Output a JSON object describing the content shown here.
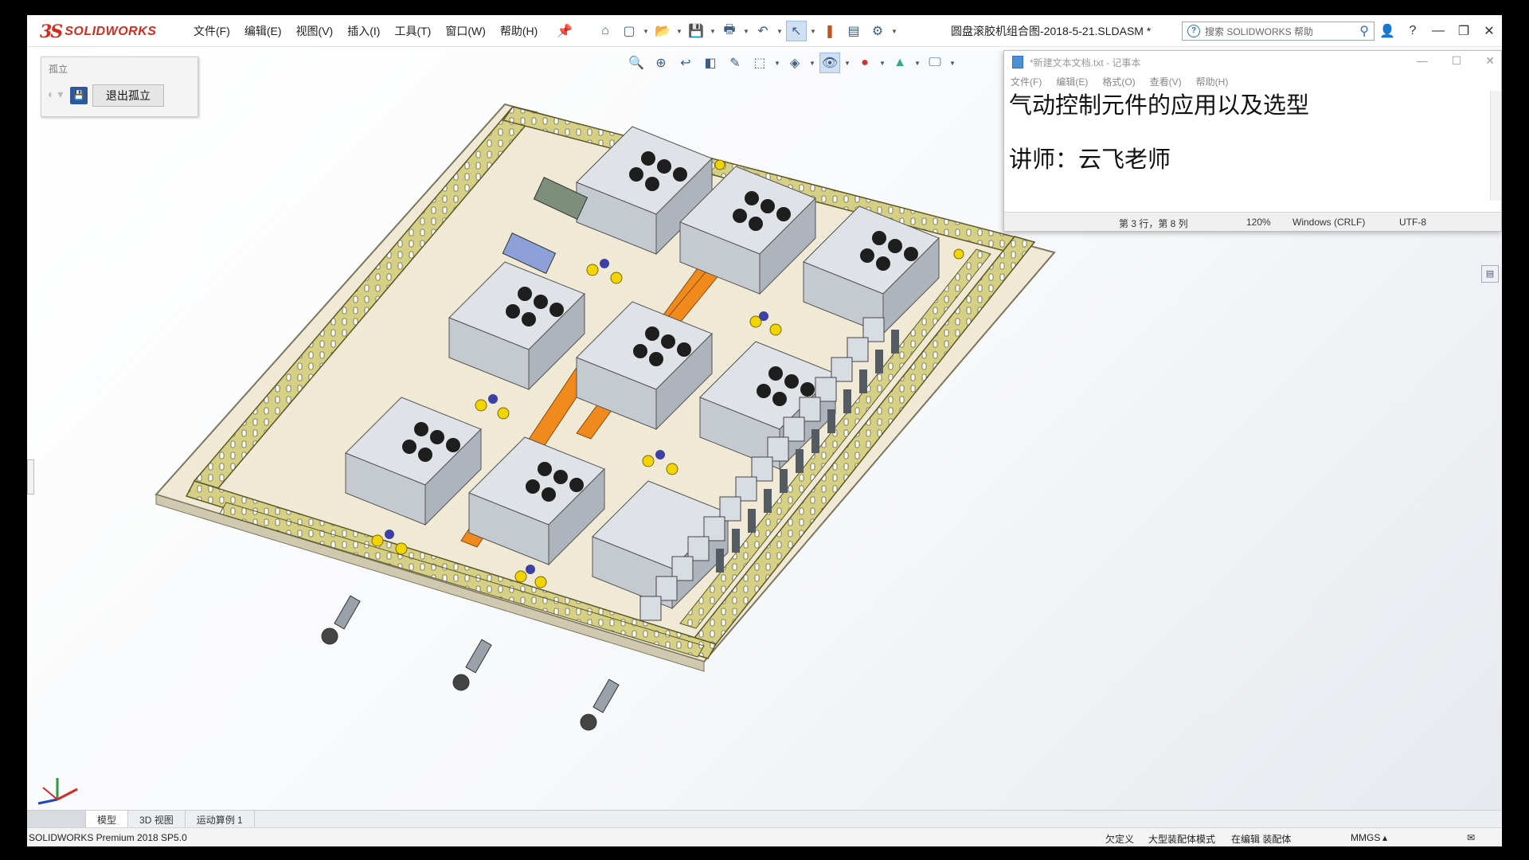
{
  "app": {
    "logo_mark": "3S",
    "logo_text": "SOLIDWORKS",
    "document_title": "圆盘滚胶机组合图-2018-5-21.SLDASM *"
  },
  "menu": [
    "文件(F)",
    "编辑(E)",
    "视图(V)",
    "插入(I)",
    "工具(T)",
    "窗口(W)",
    "帮助(H)"
  ],
  "search": {
    "placeholder": "搜索 SOLIDWORKS 帮助"
  },
  "isolate_panel": {
    "title": "孤立",
    "exit_label": "退出孤立"
  },
  "notepad": {
    "title": "*新建文本文档.txt - 记事本",
    "menu": [
      "文件(F)",
      "编辑(E)",
      "格式(O)",
      "查看(V)",
      "帮助(H)"
    ],
    "lines": [
      "气动控制元件的应用以及选型",
      "讲师：云飞老师"
    ],
    "status": {
      "position": "第 3 行，第 8 列",
      "zoom": "120%",
      "line_ending": "Windows (CRLF)",
      "encoding": "UTF-8"
    }
  },
  "tabs": [
    "模型",
    "3D 视图",
    "运动算例 1"
  ],
  "statusbar": {
    "product": "SOLIDWORKS Premium 2018 SP5.0",
    "state1": "欠定义",
    "state2": "大型装配体模式",
    "state3": "在编辑 装配体",
    "units": "MMGS"
  },
  "icons": {
    "toolbar1": [
      "home-icon",
      "new-icon",
      "open-icon",
      "save-icon",
      "print-icon",
      "undo-icon",
      "select-icon",
      "traffic-light-icon",
      "file-properties-icon",
      "options-icon"
    ],
    "toolbar2": [
      "zoom-to-fit-icon",
      "zoom-area-icon",
      "previous-view-icon",
      "section-view-icon",
      "dynamic-annotation-icon",
      "view-orientation-icon",
      "display-style-icon",
      "hide-show-icon",
      "edit-appearance-icon",
      "apply-scene-icon",
      "view-settings-icon"
    ]
  },
  "colors": {
    "brand": "#d52b1e",
    "tray": "#cfc77f",
    "rail": "#f08a1c",
    "fitting": "#f2d400"
  }
}
